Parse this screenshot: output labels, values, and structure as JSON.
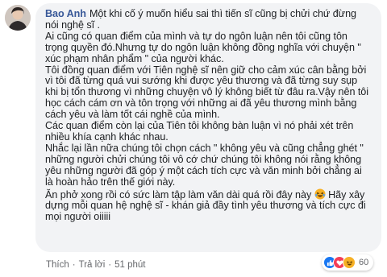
{
  "comment": {
    "author": "Bao Anh",
    "paragraphs": [
      "Một khi cố ý muốn hiểu sai thì tiến sĩ cũng bị chửi chứ đừng nói nghệ sĩ .",
      "Ai cũng có quan điểm của mình và tự do ngôn luận nên tôi cũng tôn trọng quyền đó.Nhưng tự do ngôn luận không đồng nghĩa với chuyện \" xúc phạm nhân phẩm \" của người khác.",
      "Tôi đồng quan điểm với Tiên nghệ sĩ nên giữ cho cảm xúc cân bằng bởi vì tôi đã từng quá vui sướng khi được yêu thương và đã từng suy sụp khi bị tổn thương vì những chuyện vô lý không biết từ đâu ra.Vậy nên tôi học cách cám ơn và tôn trọng với những ai đã yêu thương mình bằng cách yêu và làm tốt cái nghề của mình.",
      "Các quan điểm còn lại của Tiên tôi không bàn luận vì nó phải xét trên nhiều khía cạnh khác nhau.",
      "Nhắc lại lần nữa chúng tôi chọn cách \" không yêu và cũng chẳng ghét \" những người chửi chúng tôi vô cớ chứ chúng tôi không nói rằng không yêu những người đã góp ý một cách tích cực và văn minh bởi chẳng ai là hoàn hảo trên thế giới này.",
      "Ăn phở xong rồi có sức làm tập làm văn dài quá rồi đây này",
      "Hãy xây dựng mỗi quan hệ nghệ sĩ - khán giả đầy tình yêu thương và tích cực đi mọi người oiiiii"
    ]
  },
  "actions": {
    "like": "Thích",
    "reply": "Trả lời",
    "time": "51 phút"
  },
  "reactions": {
    "count": "60",
    "icons": [
      "like-icon",
      "love-icon",
      "haha-icon"
    ]
  },
  "colors": {
    "author": "#385898",
    "bubble": "#f2f3f5",
    "meta": "#65676b",
    "like": "#1877f2",
    "love": "#f33e58",
    "haha": "#f7b125"
  }
}
